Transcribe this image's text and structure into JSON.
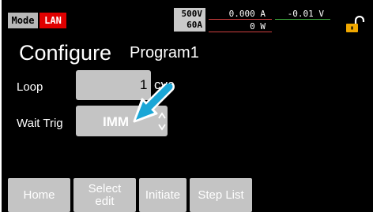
{
  "status_bar": {
    "mode_label": "Mode",
    "interface_label": "LAN",
    "voltage_range": "500V",
    "current_range": "60A",
    "current_reading": "0.000 A",
    "voltage_reading": "-0.01 V",
    "power_reading": "0 W"
  },
  "header": {
    "title": "Configure",
    "program": "Program1"
  },
  "fields": {
    "loop": {
      "label": "Loop",
      "value": "1",
      "unit": "cyc"
    },
    "wait_trig": {
      "label": "Wait Trig",
      "value": "IMM"
    }
  },
  "softkeys": {
    "home": "Home",
    "select_edit": "Select\nedit",
    "initiate": "Initiate",
    "step_list": "Step List"
  },
  "colors": {
    "lan_badge": "#e00000",
    "lock_icon": "#f0a800",
    "arrow": "#1aa6d6",
    "current_underline": "#d04040",
    "voltage_underline": "#40b040"
  },
  "icons": [
    "lock-icon",
    "spinner-icon",
    "pointer-arrow-icon"
  ]
}
